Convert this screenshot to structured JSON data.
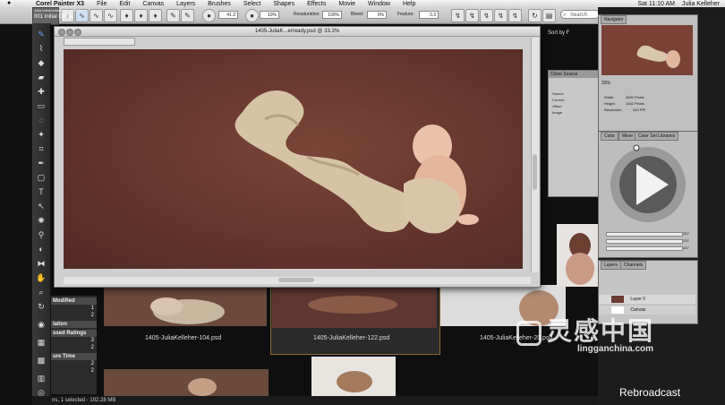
{
  "menubar": {
    "app": "Corel Painter X3",
    "items": [
      "File",
      "Edit",
      "Canvas",
      "Layers",
      "Brushes",
      "Select",
      "Shapes",
      "Effects",
      "Movie",
      "Window",
      "Help"
    ],
    "clock": "Sat 11:10 AM",
    "user": "Julia Kelleher"
  },
  "brush": {
    "category": "Julia intermediate with Weather",
    "variant": "001 Initial Clone"
  },
  "propbar": {
    "size_value": "41.2",
    "opacity_value": "10%",
    "resaturation_label": "Resaturation:",
    "resaturation_value": "100%",
    "bleed_label": "Bleed:",
    "bleed_value": "0%",
    "feature_label": "Feature:",
    "feature_value": "3.3",
    "search_placeholder": "Search"
  },
  "document": {
    "title": "1405-JuliaK...erready.psd @ 33.3%"
  },
  "browser": {
    "sort_label": "Sort by F",
    "thumbnails": [
      {
        "caption": "1405-JuliaKelleher-104.psd"
      },
      {
        "caption": "1405-JuliaKelleher-122.psd"
      },
      {
        "caption": "1405-JuliaKelleher-20.psd"
      }
    ]
  },
  "library": {
    "header1": "Modified",
    "rows1": [
      {
        "label": "",
        "value": "1"
      },
      {
        "label": "",
        "value": "2"
      }
    ],
    "header2": "lation",
    "header3": "ssed Ratings",
    "rows3": [
      {
        "label": "",
        "value": "3"
      },
      {
        "label": "",
        "value": "2"
      }
    ],
    "header4": "ure Time",
    "rows4": [
      {
        "label": "",
        "value": "2"
      },
      {
        "label": "",
        "value": "2"
      }
    ]
  },
  "clone_source": {
    "title": "Clone Source",
    "source_label": "Source",
    "opt1": "Current",
    "opt2": "Offset",
    "opt3": "Image"
  },
  "navigator": {
    "tab": "Navigator",
    "zoom": "33%",
    "width_label": "Width:",
    "width_value": "3000 Pixels",
    "height_label": "Height:",
    "height_value": "1452 Pixels",
    "resolution_label": "Resolution:",
    "resolution_value": "240 PPI"
  },
  "color": {
    "tabs": [
      "Color",
      "Mixer",
      "Color Set Libraries"
    ],
    "r_value": "237",
    "g_value": "237",
    "b_value": "237"
  },
  "layers": {
    "tabs": [
      "Layers",
      "Channels"
    ],
    "layer_name": "Layer 0",
    "canvas_name": "Canvas"
  },
  "status": {
    "text": "ns, 1 selected - 102.28 MB"
  },
  "watermark": {
    "brand": "灵感中国",
    "url": "lingganchina.com"
  },
  "rebroadcast": "Rebroadcast"
}
